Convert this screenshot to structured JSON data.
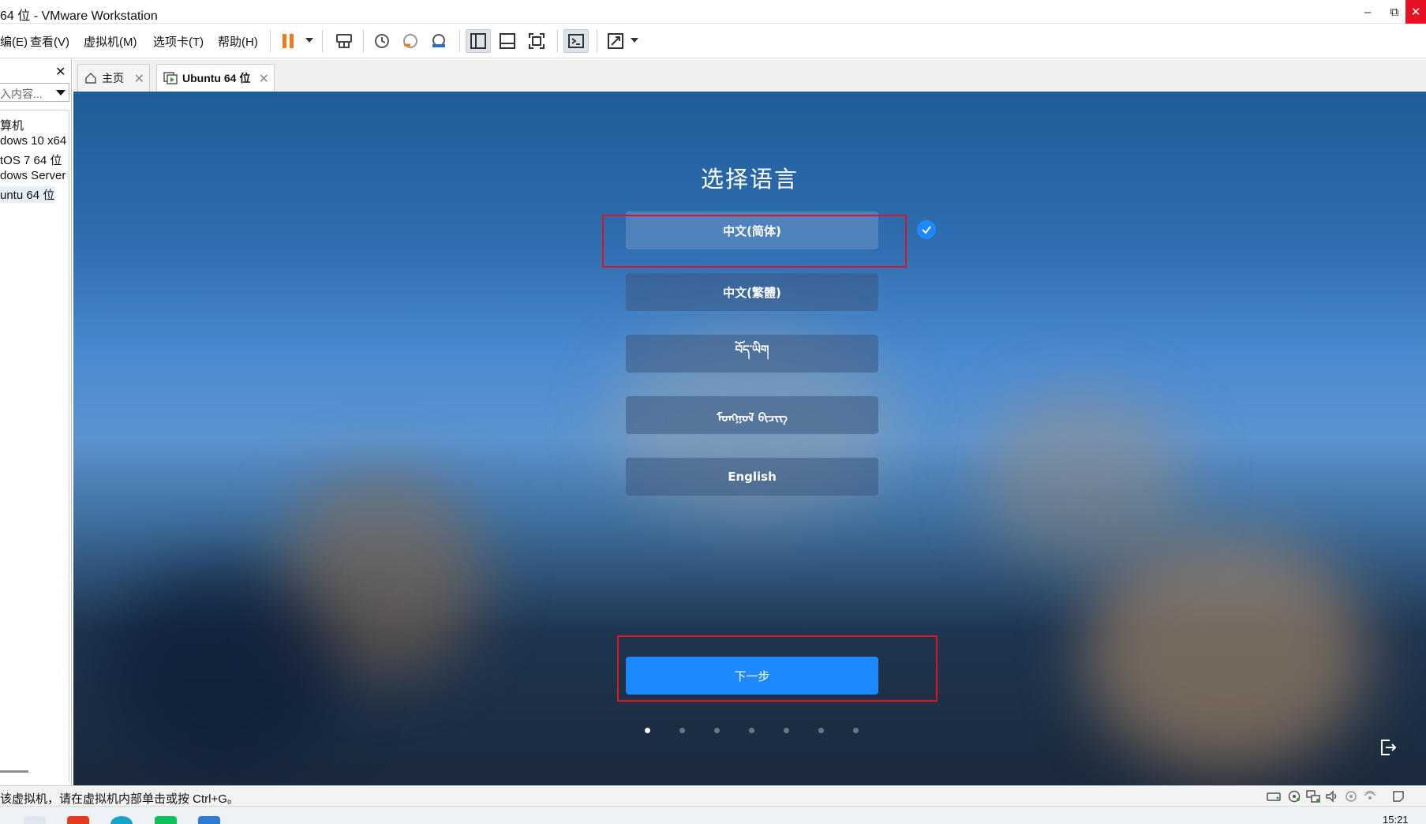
{
  "window": {
    "title": "64 位 - VMware Workstation",
    "minimize": "–",
    "restore": "⧉",
    "close": "✕"
  },
  "menu": [
    "编(E)",
    "查看(V)",
    "虚拟机(M)",
    "选项卡(T)",
    "帮助(H)"
  ],
  "toolbar_icons": [
    "pause-icon",
    "send-keys-icon",
    "snapshot-icon",
    "revert-snapshot-icon",
    "snapshot-manager-icon",
    "library-view-icon",
    "thumbnail-view-icon",
    "fullscreen-icon",
    "console-icon",
    "stretch-icon"
  ],
  "sidebar": {
    "close": "✕",
    "search_placeholder": "入内容...",
    "items": [
      {
        "label": "算机"
      },
      {
        "label": "dows 10 x64"
      },
      {
        "label": "tOS 7 64 位"
      },
      {
        "label": "dows Server"
      },
      {
        "label": "untu 64 位",
        "selected": true
      }
    ]
  },
  "tabs": [
    {
      "label": "主页",
      "icon": "home-icon",
      "close": "✕"
    },
    {
      "label": "Ubuntu 64 位",
      "icon": "vm-running-icon",
      "close": "✕",
      "active": true
    }
  ],
  "vm": {
    "heading": "选择语言",
    "languages": [
      {
        "label": "中文(简体)",
        "selected": true
      },
      {
        "label": "中文(繁體)"
      },
      {
        "label": "བོད་ཡིག"
      },
      {
        "label": "ᠮᠣᠩᠭᠣᠯ ᠪᠢᠴᠢᠭ"
      },
      {
        "label": "English"
      }
    ],
    "next_label": "下一步",
    "steps_total": 7,
    "current_step": 1,
    "accent": "#1e88ff"
  },
  "status": {
    "text": "该虚拟机，请在虚拟机内部单击或按 Ctrl+G。",
    "icons": [
      "hard-disk-icon",
      "cd-icon",
      "network-icon",
      "sound-icon",
      "usb-icon",
      "printer-icon",
      "message-icon"
    ]
  },
  "taskbar": {
    "clock": "15:21"
  }
}
